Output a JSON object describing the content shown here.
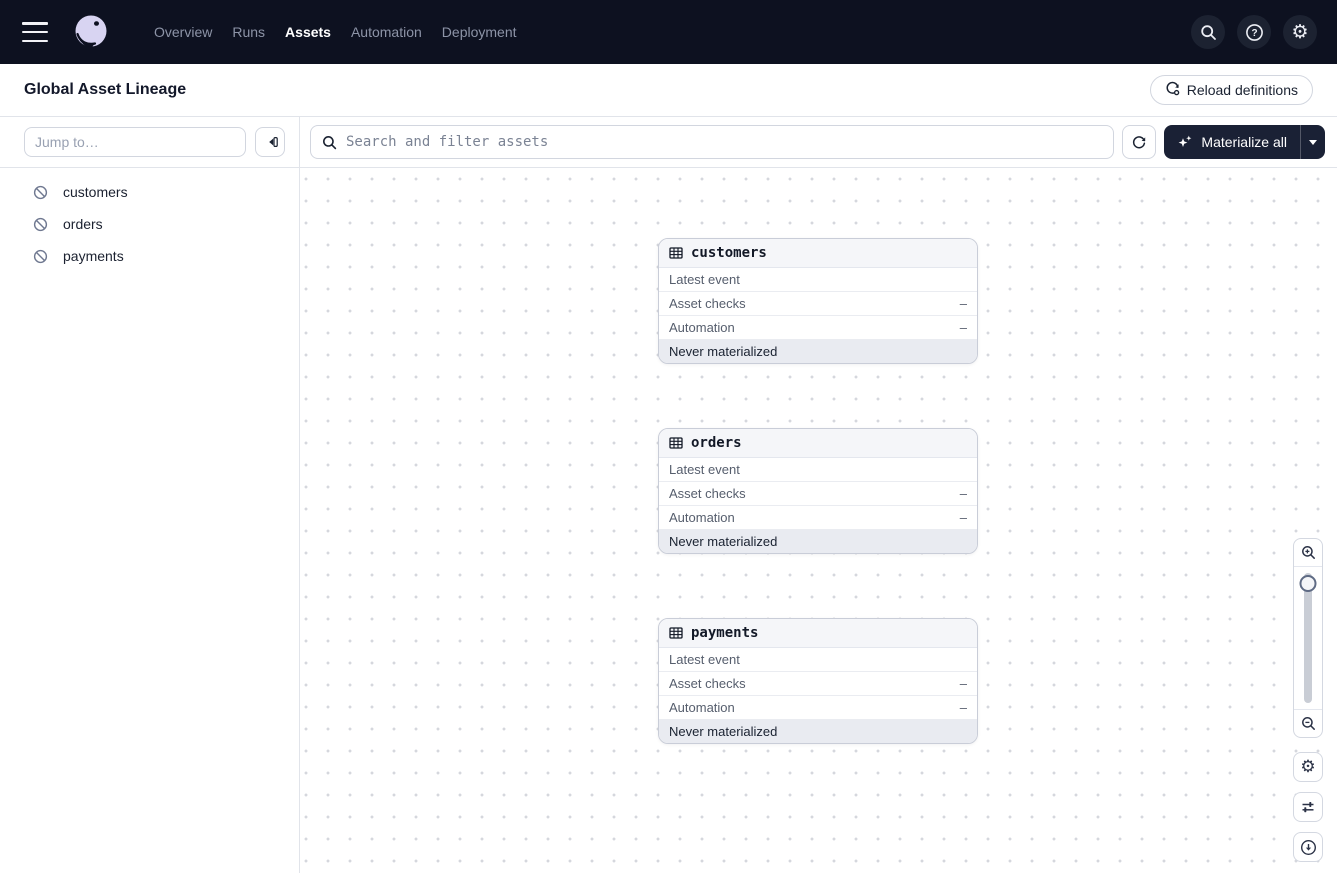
{
  "topnav": {
    "items": [
      {
        "label": "Overview",
        "active": false
      },
      {
        "label": "Runs",
        "active": false
      },
      {
        "label": "Assets",
        "active": true
      },
      {
        "label": "Automation",
        "active": false
      },
      {
        "label": "Deployment",
        "active": false
      }
    ]
  },
  "header": {
    "title": "Global Asset Lineage",
    "reload_button_label": "Reload definitions"
  },
  "sidebar": {
    "jump_placeholder": "Jump to…",
    "assets": [
      {
        "name": "customers"
      },
      {
        "name": "orders"
      },
      {
        "name": "payments"
      }
    ]
  },
  "toolbar": {
    "search_placeholder": "Search and filter assets",
    "materialize_label": "Materialize all"
  },
  "graph": {
    "nodes": [
      {
        "name": "customers",
        "rows": [
          {
            "label": "Latest event",
            "value": ""
          },
          {
            "label": "Asset checks",
            "value": "–"
          },
          {
            "label": "Automation",
            "value": "–"
          }
        ],
        "status": "Never materialized"
      },
      {
        "name": "orders",
        "rows": [
          {
            "label": "Latest event",
            "value": ""
          },
          {
            "label": "Asset checks",
            "value": "–"
          },
          {
            "label": "Automation",
            "value": "–"
          }
        ],
        "status": "Never materialized"
      },
      {
        "name": "payments",
        "rows": [
          {
            "label": "Latest event",
            "value": ""
          },
          {
            "label": "Asset checks",
            "value": "–"
          },
          {
            "label": "Automation",
            "value": "–"
          }
        ],
        "status": "Never materialized"
      }
    ]
  },
  "colors": {
    "topnav_bg": "#0d1120",
    "accent_button_bg": "#1a2135",
    "logo_lavender": "#d8d4f2",
    "node_footer_bg": "#e9ebf1",
    "canvas_dot": "#d5d7dd"
  }
}
